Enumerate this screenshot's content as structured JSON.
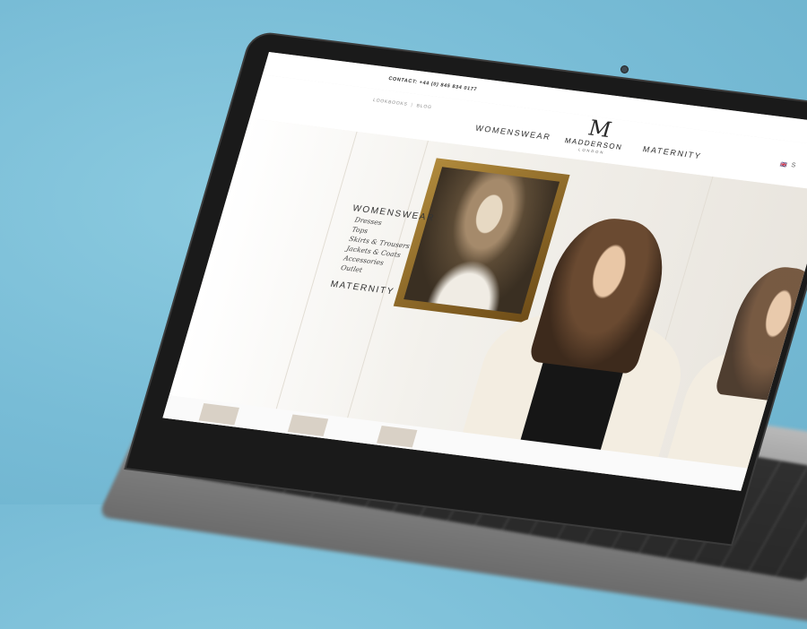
{
  "site": {
    "contact": "CONTACT: +44 (0) 845 834 0177",
    "util_links": [
      "LOOKBOOKS",
      "BLOG"
    ],
    "nav_left": "WOMENSWEAR",
    "nav_right": "MATERNITY",
    "logo": {
      "mark": "M",
      "name": "MADDERSON",
      "sub": "LONDON"
    },
    "lang_flag": "🇬🇧",
    "lang_label": "S"
  },
  "side_menu": {
    "heading": "WOMENSWEAR",
    "items": [
      "Dresses",
      "Tops",
      "Skirts & Trousers",
      "Jackets & Coats",
      "Accessories",
      "Outlet"
    ],
    "heading2": "MATERNITY"
  },
  "colors": {
    "background": "#78bcd6",
    "screen_bg": "#f4f1ec",
    "text": "#333333",
    "frame": "#b08a3c"
  }
}
